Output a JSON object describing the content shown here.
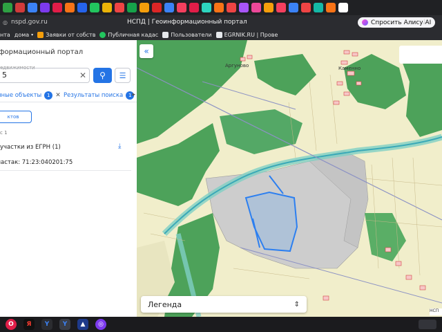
{
  "browser": {
    "url": "nspd.gov.ru",
    "tab_title": "НСПД | Геоинформационный портал",
    "alice_label": "Спросить Алису AI",
    "bookmarks": [
      "нта",
      "дома",
      "Заявки от собств",
      "Публичная кадас",
      "Пользователи",
      "EGRNIK.RU | Прове"
    ]
  },
  "sidebar": {
    "portal_title": "формационный портал",
    "search_label": "едвижимости",
    "search_value": "5",
    "tabs": [
      {
        "label": "нные объекты",
        "count": "1"
      },
      {
        "label": "Результаты поиска",
        "count": "1"
      }
    ],
    "objects_button": "ктов",
    "found_count": "с 1",
    "parcels_heading": "участки из ЕГРН (1)",
    "parcel_row": "частак: 71:23:040201:75"
  },
  "map": {
    "villages": [
      "Аргуново",
      "Каменно"
    ],
    "legend_label": "Легенда",
    "scale_label": "НСП",
    "colors": {
      "forest": "#4da25a",
      "land": "#f1eecb",
      "parcel_outline": "#2c7ff0",
      "parcel_fill": "#a9bfd8",
      "gray_area": "#cfcfcf",
      "river": "#7fd0c4"
    }
  },
  "taskbar": {
    "icons": [
      "opera-icon",
      "yandex-icon",
      "yandex-browser-icon",
      "yandex-browser-active-icon",
      "photos-icon",
      "messenger-icon"
    ]
  }
}
